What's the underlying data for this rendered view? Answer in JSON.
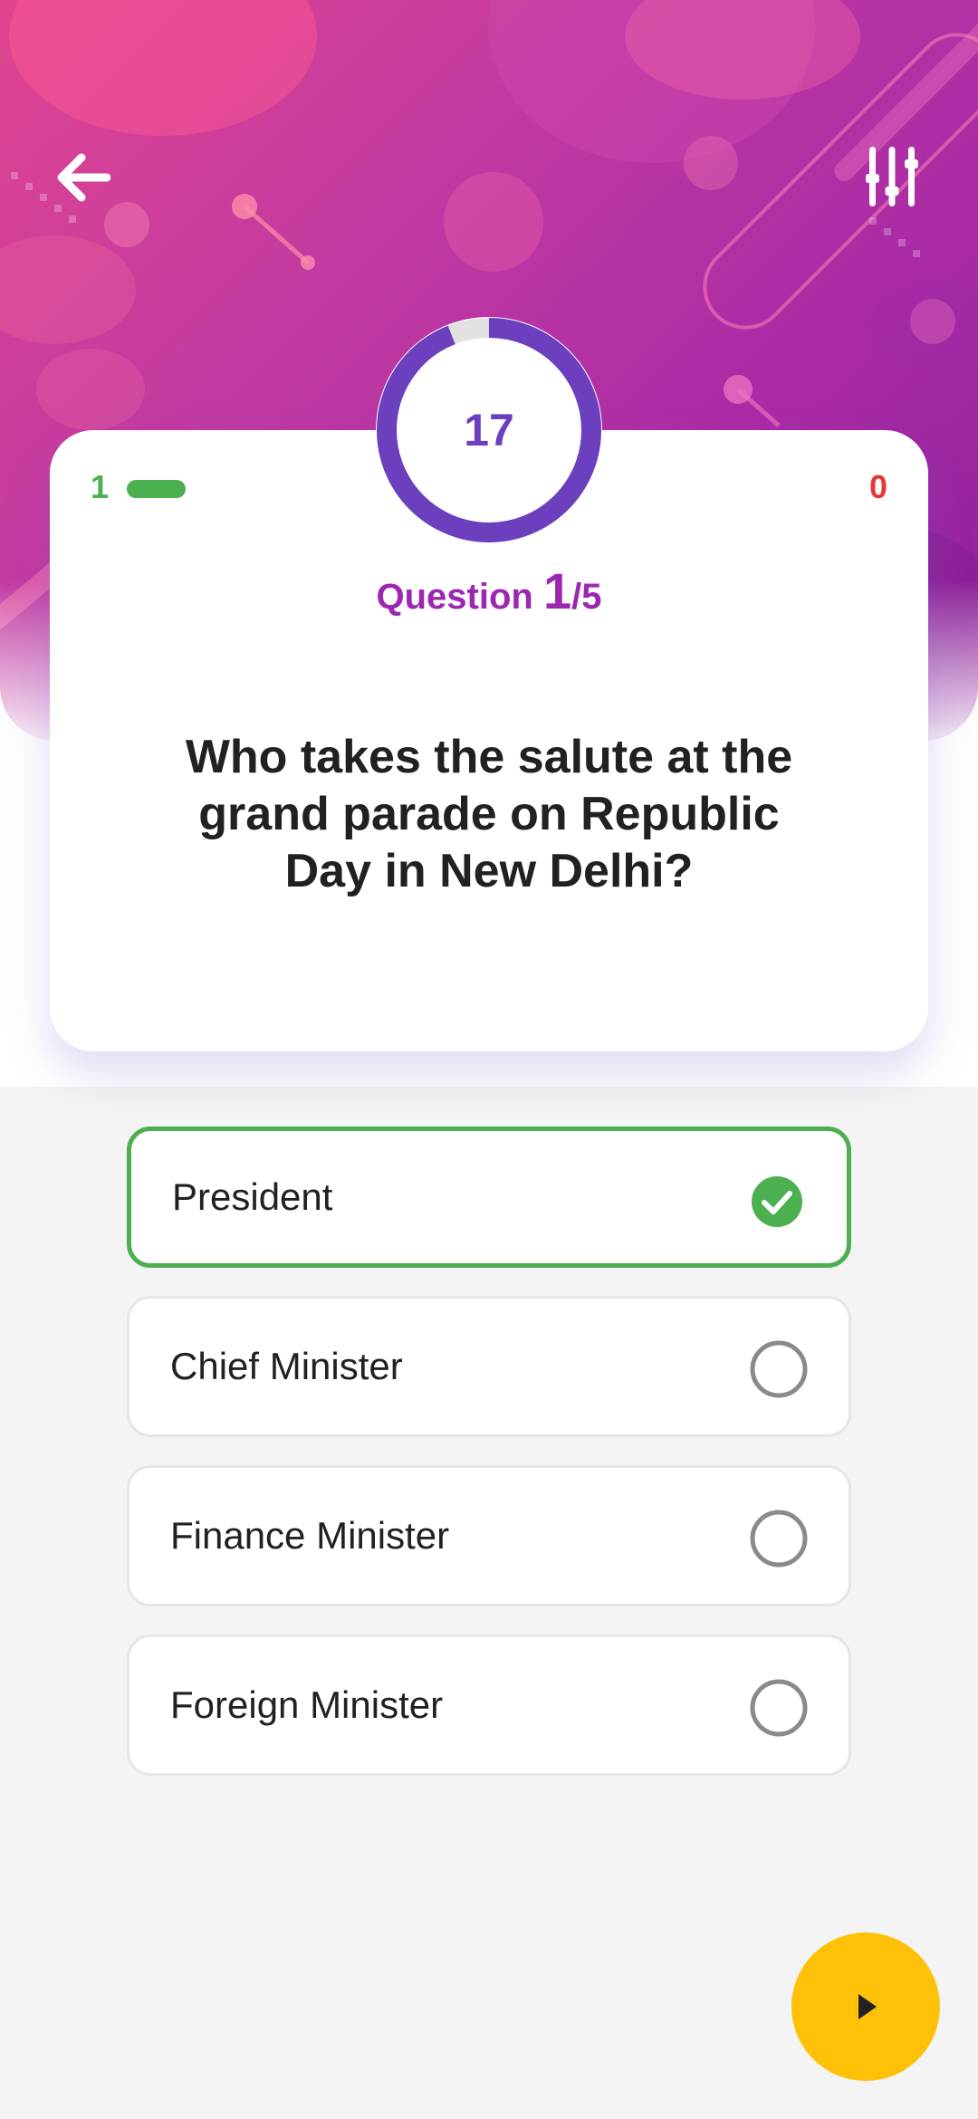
{
  "header": {
    "back_icon": "arrow-left-icon",
    "settings_icon": "sliders-icon"
  },
  "timer": {
    "seconds": "17",
    "progress_fraction": 0.94
  },
  "score": {
    "correct": "1",
    "wrong": "0"
  },
  "question": {
    "label": "Question",
    "current": "1",
    "total": "/5",
    "text": "Who takes the salute at the grand parade on Republic Day in New Delhi?"
  },
  "options": [
    {
      "label": "President",
      "selected": true
    },
    {
      "label": "Chief Minister",
      "selected": false
    },
    {
      "label": "Finance Minister",
      "selected": false
    },
    {
      "label": "Foreign Minister",
      "selected": false
    }
  ],
  "next_button": {
    "icon": "play-icon"
  },
  "colors": {
    "primary": "#6b3fbe",
    "accent_purple": "#9c27b0",
    "correct": "#4caf50",
    "wrong": "#e53935",
    "next_button": "#ffc107"
  }
}
